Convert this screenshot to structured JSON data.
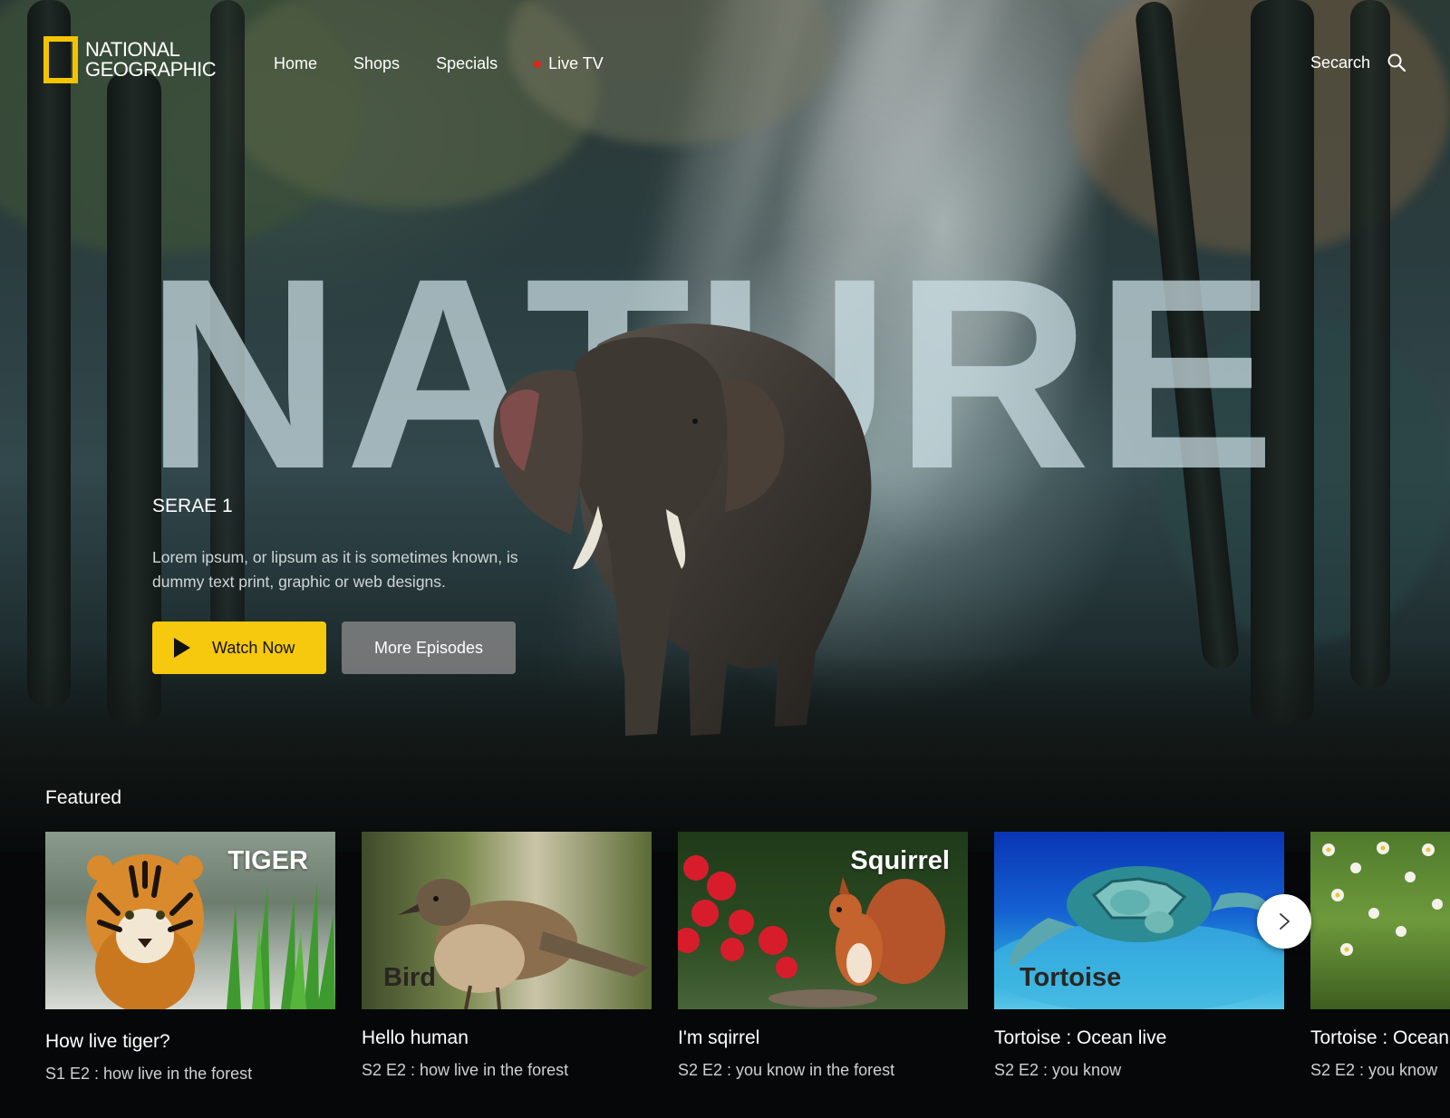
{
  "brand": {
    "line1": "NATIONAL",
    "line2": "GEOGRAPHIC",
    "accent": "#f5c400"
  },
  "nav": {
    "items": [
      {
        "label": "Home"
      },
      {
        "label": "Shops"
      },
      {
        "label": "Specials"
      },
      {
        "label": "Live TV",
        "live": true
      }
    ],
    "live_color": "#e0241b"
  },
  "search": {
    "label": "Secarch",
    "icon": "search-icon"
  },
  "hero": {
    "word": "NATURE",
    "series": "SERAE 1",
    "description": "Lorem ipsum, or lipsum as it is sometimes known, is dummy text print, graphic or web designs.",
    "watch_label": "Watch Now",
    "more_label": "More Episodes",
    "watch_color": "#f6c90e"
  },
  "featured": {
    "title": "Featured",
    "cards": [
      {
        "image_label": "TIGER",
        "title": "How live tiger?",
        "subtitle": "S1 E2 : how live in the forest"
      },
      {
        "image_label": "Bird",
        "title": "Hello human",
        "subtitle": "S2 E2 : how live in the forest"
      },
      {
        "image_label": "Squirrel",
        "title": "I'm sqirrel",
        "subtitle": "S2 E2 : you know in the forest"
      },
      {
        "image_label": "Tortoise",
        "title": "Tortoise : Ocean live",
        "subtitle": "S2 E2 : you know"
      },
      {
        "image_label": "",
        "title": "Tortoise : Ocean live",
        "subtitle": "S2 E2 : you know"
      }
    ],
    "next_icon": "chevron-right-icon"
  }
}
